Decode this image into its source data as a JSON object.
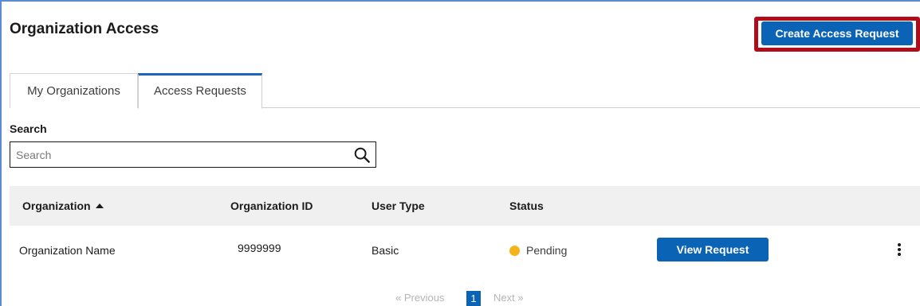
{
  "page": {
    "title": "Organization Access",
    "create_button_label": "Create Access Request"
  },
  "tabs": [
    {
      "label": "My Organizations",
      "active": false
    },
    {
      "label": "Access Requests",
      "active": true
    }
  ],
  "search": {
    "label": "Search",
    "placeholder": "Search",
    "value": ""
  },
  "table": {
    "columns": [
      {
        "label": "Organization",
        "sorted": "ascending"
      },
      {
        "label": "Organization ID"
      },
      {
        "label": "User Type"
      },
      {
        "label": "Status"
      }
    ],
    "rows": [
      {
        "organization": "Organization Name",
        "organization_id": "9999999",
        "user_type": "Basic",
        "status": "Pending",
        "status_color": "#f2b418",
        "action_label": "View Request"
      }
    ]
  },
  "pagination": {
    "previous_label": "« Previous",
    "current_page": "1",
    "next_label": "Next »"
  },
  "colors": {
    "primary": "#0b63b5",
    "highlight_border": "#b00d1b",
    "header_bg": "#f0f0f0",
    "tab_accent": "#1a66b8"
  }
}
